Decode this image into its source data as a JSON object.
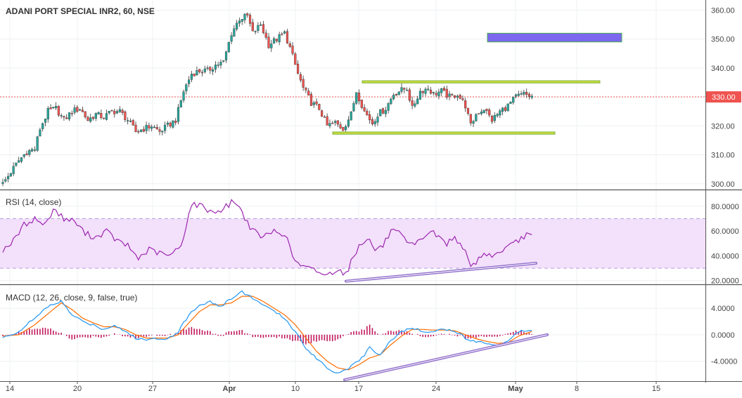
{
  "header": {
    "symbol_title": "ADANI PORT SPECIAL INR2, 60, NSE"
  },
  "colors": {
    "up_candle": "#26a69a",
    "down_candle": "#ef5350",
    "rsi_line": "#9c27b0",
    "rsi_band": "#f3e0fb",
    "macd_line": "#2196f3",
    "signal_line": "#ff6d00",
    "histogram": "#c2185b",
    "support_resistance": "#7cb342",
    "target_box": "#7b68ee",
    "trend_line": "#9575cd",
    "price_badge": "#ef5350"
  },
  "chart_data": [
    {
      "type": "candlestick",
      "panel": "price",
      "title": "ADANI PORT SPECIAL INR2, 60, NSE",
      "ylim": [
        298,
        363
      ],
      "y_ticks": [
        "360.00",
        "350.00",
        "340.00",
        "330.00",
        "320.00",
        "310.00",
        "300.00"
      ],
      "y_tick_values": [
        360,
        350,
        340,
        330,
        320,
        310,
        300
      ],
      "last_price_label": "330.00",
      "last_price": 330,
      "x_labels": [
        "14",
        "20",
        "27",
        "Apr",
        "10",
        "17",
        "24",
        "May",
        "8",
        "15"
      ],
      "close_anchors": [
        [
          0,
          300
        ],
        [
          3,
          304
        ],
        [
          6,
          308
        ],
        [
          9,
          311
        ],
        [
          12,
          312
        ],
        [
          14,
          319
        ],
        [
          17,
          325
        ],
        [
          20,
          326
        ],
        [
          23,
          322
        ],
        [
          26,
          325
        ],
        [
          29,
          326
        ],
        [
          32,
          322
        ],
        [
          35,
          324
        ],
        [
          38,
          323
        ],
        [
          41,
          325
        ],
        [
          44,
          325
        ],
        [
          47,
          322
        ],
        [
          50,
          318
        ],
        [
          53,
          319
        ],
        [
          56,
          320
        ],
        [
          59,
          318
        ],
        [
          62,
          320
        ],
        [
          65,
          322
        ],
        [
          68,
          332
        ],
        [
          71,
          338
        ],
        [
          74,
          339
        ],
        [
          77,
          339
        ],
        [
          80,
          341
        ],
        [
          83,
          342
        ],
        [
          86,
          352
        ],
        [
          89,
          357
        ],
        [
          92,
          358
        ],
        [
          94,
          352
        ],
        [
          97,
          355
        ],
        [
          100,
          348
        ],
        [
          103,
          350
        ],
        [
          106,
          352
        ],
        [
          108,
          347
        ],
        [
          111,
          338
        ],
        [
          113,
          333
        ],
        [
          116,
          328
        ],
        [
          119,
          326
        ],
        [
          122,
          320
        ],
        [
          125,
          321
        ],
        [
          128,
          319
        ],
        [
          131,
          324
        ],
        [
          133,
          332
        ],
        [
          136,
          325
        ],
        [
          139,
          321
        ],
        [
          141,
          324
        ],
        [
          144,
          326
        ],
        [
          147,
          331
        ],
        [
          149,
          332
        ],
        [
          152,
          333
        ],
        [
          154,
          326
        ],
        [
          157,
          332
        ],
        [
          160,
          333
        ],
        [
          162,
          331
        ],
        [
          165,
          332
        ],
        [
          168,
          330
        ],
        [
          171,
          331
        ],
        [
          174,
          327
        ],
        [
          176,
          320
        ],
        [
          178,
          324
        ],
        [
          181,
          326
        ],
        [
          184,
          322
        ],
        [
          187,
          325
        ],
        [
          190,
          327
        ],
        [
          193,
          330
        ],
        [
          196,
          331
        ],
        [
          199,
          330
        ]
      ],
      "annotations": [
        {
          "kind": "resistance",
          "value": 335.2,
          "from": "17",
          "to": "8"
        },
        {
          "kind": "support",
          "value": 317.5,
          "from": "17",
          "to": "May"
        },
        {
          "kind": "target_box",
          "from_value": 349,
          "to_value": 352,
          "from": "May",
          "to": "8"
        }
      ]
    },
    {
      "type": "line",
      "panel": "rsi",
      "label": "RSI (14, close)",
      "ylim": [
        17,
        93
      ],
      "y_ticks": [
        "80.0000",
        "60.0000",
        "40.0000",
        "20.0000"
      ],
      "y_tick_values": [
        80,
        60,
        40,
        20
      ],
      "band": [
        30,
        70
      ],
      "series": [
        {
          "name": "RSI",
          "values": [
            [
              0,
              45
            ],
            [
              4,
              52
            ],
            [
              8,
              65
            ],
            [
              12,
              70
            ],
            [
              16,
              65
            ],
            [
              19,
              78
            ],
            [
              23,
              70
            ],
            [
              27,
              68
            ],
            [
              31,
              58
            ],
            [
              35,
              55
            ],
            [
              39,
              60
            ],
            [
              43,
              52
            ],
            [
              47,
              48
            ],
            [
              51,
              38
            ],
            [
              55,
              45
            ],
            [
              59,
              42
            ],
            [
              63,
              40
            ],
            [
              67,
              48
            ],
            [
              71,
              82
            ],
            [
              75,
              80
            ],
            [
              79,
              75
            ],
            [
              83,
              78
            ],
            [
              87,
              85
            ],
            [
              90,
              75
            ],
            [
              94,
              60
            ],
            [
              98,
              55
            ],
            [
              102,
              60
            ],
            [
              106,
              58
            ],
            [
              110,
              35
            ],
            [
              114,
              30
            ],
            [
              118,
              28
            ],
            [
              122,
              24
            ],
            [
              126,
              30
            ],
            [
              129,
              25
            ],
            [
              131,
              35
            ],
            [
              134,
              48
            ],
            [
              137,
              55
            ],
            [
              140,
              45
            ],
            [
              143,
              48
            ],
            [
              146,
              60
            ],
            [
              149,
              58
            ],
            [
              152,
              50
            ],
            [
              155,
              48
            ],
            [
              158,
              55
            ],
            [
              161,
              60
            ],
            [
              164,
              55
            ],
            [
              167,
              50
            ],
            [
              170,
              55
            ],
            [
              173,
              48
            ],
            [
              176,
              30
            ],
            [
              179,
              38
            ],
            [
              182,
              42
            ],
            [
              185,
              40
            ],
            [
              188,
              45
            ],
            [
              191,
              48
            ],
            [
              194,
              52
            ],
            [
              197,
              58
            ],
            [
              199,
              55
            ]
          ]
        }
      ],
      "annotations": [
        {
          "kind": "trend_line",
          "from_value": 19.5,
          "to_value": 34,
          "from": "17",
          "to": "May"
        }
      ]
    },
    {
      "type": "line",
      "panel": "macd",
      "label": "MACD (12, 26, close, 9, false, true)",
      "ylim": [
        -7,
        7.5
      ],
      "y_ticks": [
        "4.0000",
        "0.0000",
        "-4.0000"
      ],
      "y_tick_values": [
        4,
        0,
        -4
      ],
      "series": [
        {
          "name": "MACD",
          "values": [
            [
              0,
              -0.5
            ],
            [
              6,
              0.5
            ],
            [
              12,
              2.5
            ],
            [
              18,
              4.5
            ],
            [
              22,
              5
            ],
            [
              26,
              3
            ],
            [
              30,
              2
            ],
            [
              34,
              1.5
            ],
            [
              38,
              0.8
            ],
            [
              42,
              1.5
            ],
            [
              46,
              0.5
            ],
            [
              50,
              -0.5
            ],
            [
              54,
              -0.8
            ],
            [
              58,
              -0.5
            ],
            [
              62,
              -0.6
            ],
            [
              66,
              0.5
            ],
            [
              70,
              3
            ],
            [
              74,
              4.5
            ],
            [
              78,
              5
            ],
            [
              82,
              4.2
            ],
            [
              86,
              5.5
            ],
            [
              90,
              6.5
            ],
            [
              94,
              5.5
            ],
            [
              98,
              4.5
            ],
            [
              102,
              3.5
            ],
            [
              106,
              2.5
            ],
            [
              110,
              0.5
            ],
            [
              114,
              -2
            ],
            [
              118,
              -3.5
            ],
            [
              122,
              -5
            ],
            [
              126,
              -5.8
            ],
            [
              130,
              -5
            ],
            [
              134,
              -4
            ],
            [
              138,
              -2
            ],
            [
              142,
              -3
            ],
            [
              146,
              -0.8
            ],
            [
              150,
              0.5
            ],
            [
              154,
              1
            ],
            [
              158,
              0.5
            ],
            [
              162,
              0.6
            ],
            [
              166,
              0.8
            ],
            [
              170,
              0.6
            ],
            [
              174,
              -0.5
            ],
            [
              178,
              -1
            ],
            [
              182,
              -1.3
            ],
            [
              186,
              -1.5
            ],
            [
              190,
              -1
            ],
            [
              194,
              0.5
            ],
            [
              199,
              0.8
            ]
          ]
        },
        {
          "name": "Signal",
          "values": [
            [
              0,
              -0.2
            ],
            [
              6,
              0
            ],
            [
              12,
              1.5
            ],
            [
              18,
              3.5
            ],
            [
              22,
              4.8
            ],
            [
              26,
              3.8
            ],
            [
              30,
              2.5
            ],
            [
              34,
              1.8
            ],
            [
              38,
              1.2
            ],
            [
              42,
              1.2
            ],
            [
              46,
              0.8
            ],
            [
              50,
              0
            ],
            [
              54,
              -0.5
            ],
            [
              58,
              -0.5
            ],
            [
              62,
              -0.5
            ],
            [
              66,
              0
            ],
            [
              70,
              1.8
            ],
            [
              74,
              3.5
            ],
            [
              78,
              4.5
            ],
            [
              82,
              4.5
            ],
            [
              86,
              4.8
            ],
            [
              90,
              5.8
            ],
            [
              94,
              5.8
            ],
            [
              98,
              5
            ],
            [
              102,
              4
            ],
            [
              106,
              3
            ],
            [
              110,
              1.5
            ],
            [
              114,
              -0.5
            ],
            [
              118,
              -2.5
            ],
            [
              122,
              -4
            ],
            [
              126,
              -5
            ],
            [
              130,
              -5.3
            ],
            [
              134,
              -4.5
            ],
            [
              138,
              -3.5
            ],
            [
              142,
              -3
            ],
            [
              146,
              -1.5
            ],
            [
              150,
              -0.2
            ],
            [
              154,
              0.8
            ],
            [
              158,
              0.8
            ],
            [
              162,
              0.7
            ],
            [
              166,
              0.7
            ],
            [
              170,
              0.6
            ],
            [
              174,
              0
            ],
            [
              178,
              -0.6
            ],
            [
              182,
              -1
            ],
            [
              186,
              -1.3
            ],
            [
              190,
              -1.2
            ],
            [
              194,
              -0.2
            ],
            [
              199,
              0.5
            ]
          ]
        },
        {
          "name": "Histogram",
          "values": []
        }
      ],
      "annotations": [
        {
          "kind": "trend_line",
          "from_value": -6.8,
          "to_value": 0,
          "from": "17",
          "to": "8"
        }
      ]
    }
  ]
}
